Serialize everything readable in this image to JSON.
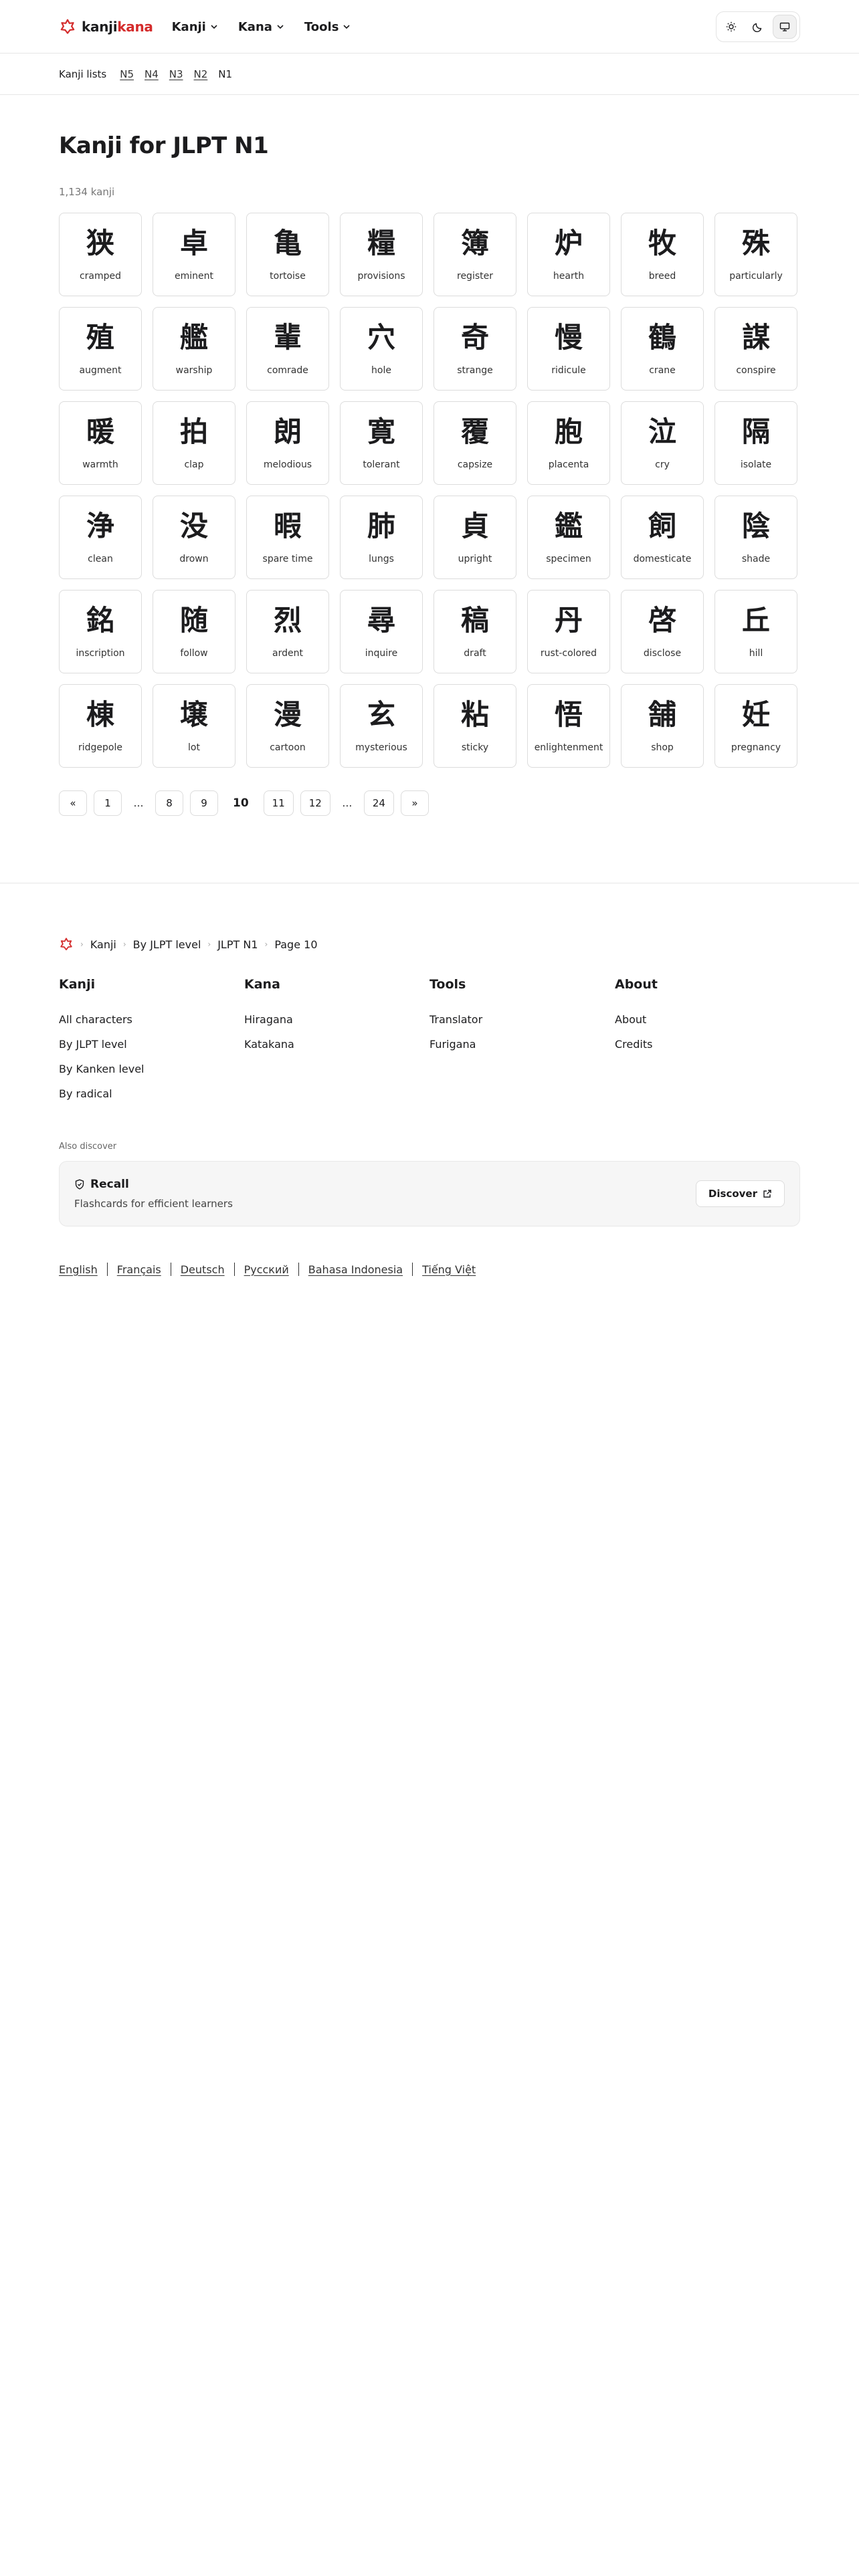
{
  "header": {
    "brand_kanji": "kanji",
    "brand_kana": "kana",
    "nav": [
      {
        "label": "Kanji"
      },
      {
        "label": "Kana"
      },
      {
        "label": "Tools"
      }
    ],
    "theme_active": "system"
  },
  "subnav": {
    "title": "Kanji lists",
    "levels": [
      "N5",
      "N4",
      "N3",
      "N2"
    ],
    "current": "N1"
  },
  "main": {
    "title": "Kanji for JLPT N1",
    "count": "1,134 kanji",
    "cards": [
      {
        "k": "狭",
        "m": "cramped"
      },
      {
        "k": "卓",
        "m": "eminent"
      },
      {
        "k": "亀",
        "m": "tortoise"
      },
      {
        "k": "糧",
        "m": "provisions"
      },
      {
        "k": "簿",
        "m": "register"
      },
      {
        "k": "炉",
        "m": "hearth"
      },
      {
        "k": "牧",
        "m": "breed"
      },
      {
        "k": "殊",
        "m": "particularly"
      },
      {
        "k": "殖",
        "m": "augment"
      },
      {
        "k": "艦",
        "m": "warship"
      },
      {
        "k": "輩",
        "m": "comrade"
      },
      {
        "k": "穴",
        "m": "hole"
      },
      {
        "k": "奇",
        "m": "strange"
      },
      {
        "k": "慢",
        "m": "ridicule"
      },
      {
        "k": "鶴",
        "m": "crane"
      },
      {
        "k": "謀",
        "m": "conspire"
      },
      {
        "k": "暖",
        "m": "warmth"
      },
      {
        "k": "拍",
        "m": "clap"
      },
      {
        "k": "朗",
        "m": "melodious"
      },
      {
        "k": "寛",
        "m": "tolerant"
      },
      {
        "k": "覆",
        "m": "capsize"
      },
      {
        "k": "胞",
        "m": "placenta"
      },
      {
        "k": "泣",
        "m": "cry"
      },
      {
        "k": "隔",
        "m": "isolate"
      },
      {
        "k": "浄",
        "m": "clean"
      },
      {
        "k": "没",
        "m": "drown"
      },
      {
        "k": "暇",
        "m": "spare time"
      },
      {
        "k": "肺",
        "m": "lungs"
      },
      {
        "k": "貞",
        "m": "upright"
      },
      {
        "k": "鑑",
        "m": "specimen"
      },
      {
        "k": "飼",
        "m": "domesticate"
      },
      {
        "k": "陰",
        "m": "shade"
      },
      {
        "k": "銘",
        "m": "inscription"
      },
      {
        "k": "随",
        "m": "follow"
      },
      {
        "k": "烈",
        "m": "ardent"
      },
      {
        "k": "尋",
        "m": "inquire"
      },
      {
        "k": "稿",
        "m": "draft"
      },
      {
        "k": "丹",
        "m": "rust-colored"
      },
      {
        "k": "啓",
        "m": "disclose"
      },
      {
        "k": "丘",
        "m": "hill"
      },
      {
        "k": "棟",
        "m": "ridgepole"
      },
      {
        "k": "壌",
        "m": "lot"
      },
      {
        "k": "漫",
        "m": "cartoon"
      },
      {
        "k": "玄",
        "m": "mysterious"
      },
      {
        "k": "粘",
        "m": "sticky"
      },
      {
        "k": "悟",
        "m": "enlightenment"
      },
      {
        "k": "舗",
        "m": "shop"
      },
      {
        "k": "妊",
        "m": "pregnancy"
      }
    ],
    "pagination": [
      {
        "label": "«",
        "type": "link"
      },
      {
        "label": "1",
        "type": "link"
      },
      {
        "label": "…",
        "type": "ellipsis"
      },
      {
        "label": "8",
        "type": "link"
      },
      {
        "label": "9",
        "type": "link"
      },
      {
        "label": "10",
        "type": "current"
      },
      {
        "label": "11",
        "type": "link"
      },
      {
        "label": "12",
        "type": "link"
      },
      {
        "label": "…",
        "type": "ellipsis"
      },
      {
        "label": "24",
        "type": "link"
      },
      {
        "label": "»",
        "type": "link"
      }
    ]
  },
  "footer": {
    "breadcrumb": [
      "Kanji",
      "By JLPT level",
      "JLPT N1",
      "Page 10"
    ],
    "columns": [
      {
        "title": "Kanji",
        "links": [
          "All characters",
          "By JLPT level",
          "By Kanken level",
          "By radical"
        ]
      },
      {
        "title": "Kana",
        "links": [
          "Hiragana",
          "Katakana"
        ]
      },
      {
        "title": "Tools",
        "links": [
          "Translator",
          "Furigana"
        ]
      },
      {
        "title": "About",
        "links": [
          "About",
          "Credits"
        ]
      }
    ],
    "also_discover": "Also discover",
    "promo": {
      "title": "Recall",
      "subtitle": "Flashcards for efficient learners",
      "button": "Discover"
    },
    "languages": [
      "English",
      "Français",
      "Deutsch",
      "Русский",
      "Bahasa Indonesia",
      "Tiếng Việt"
    ]
  },
  "colors": {
    "brand_red": "#d42b2b",
    "text": "#1c1c1e",
    "border": "#dcdcdc"
  }
}
